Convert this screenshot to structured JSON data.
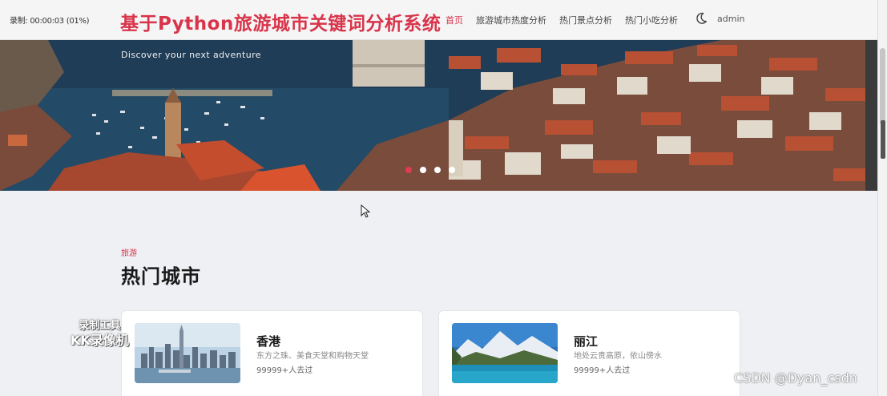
{
  "recorder": {
    "timestamp": "录制: 00:00:03 (01%)"
  },
  "header": {
    "title": "基于Python旅游城市关键词分析系统",
    "nav": [
      "首页",
      "旅游城市热度分析",
      "热门景点分析",
      "热门小吃分析"
    ],
    "user": "admin"
  },
  "hero": {
    "subtitle": "Discover your next adventure",
    "slides": 4,
    "active_slide": 1
  },
  "section": {
    "tag": "旅游",
    "title": "热门城市"
  },
  "cities": [
    {
      "name": "香港",
      "desc": "东方之珠、美食天堂和购物天堂",
      "visits": "99999+人去过"
    },
    {
      "name": "丽江",
      "desc": "地处云贵高原，依山傍水",
      "visits": "99999+人去过"
    }
  ],
  "overlays": {
    "watermark_line1": "录制工具",
    "watermark_line2": "KK录像机",
    "csdn": "CSDN @Dyan_csdn"
  },
  "colors": {
    "accent": "#d8344a",
    "dot_active": "#e23a55"
  }
}
